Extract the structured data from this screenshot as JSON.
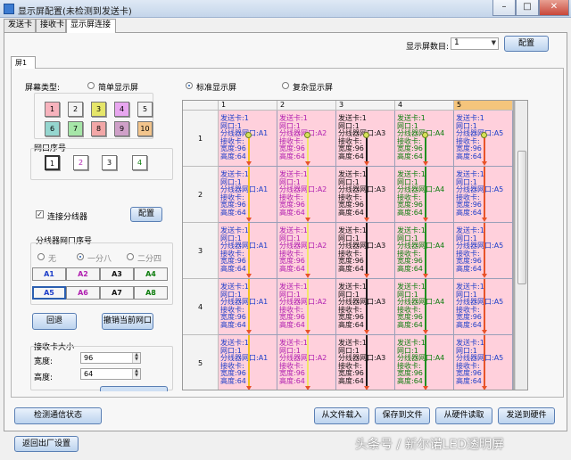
{
  "window": {
    "title": "显示屏配置(未检测到发送卡)",
    "minimize_glyph": "–",
    "maximize_glyph": "□",
    "close_glyph": "✕"
  },
  "main_tabs": [
    "发送卡",
    "接收卡",
    "显示屏连接"
  ],
  "screen_count": {
    "label": "显示屏数目:",
    "value": "1",
    "config_button": "配置"
  },
  "screen_tabs": [
    "屏1"
  ],
  "screen_type": {
    "label": "屏幕类型:",
    "options": [
      "简单显示屏",
      "标准显示屏",
      "复杂显示屏"
    ],
    "selected": "标准显示屏"
  },
  "palette": {
    "labels": [
      "1",
      "2",
      "3",
      "4",
      "5",
      "6",
      "7",
      "8",
      "9",
      "10"
    ],
    "colors": [
      "#f7b3bd",
      "#f2f2f2",
      "#e6e66a",
      "#e8a6ef",
      "#f3f3f3",
      "#95d6cf",
      "#a6e6a8",
      "#f2a7a7",
      "#cfa0c8",
      "#f3c58c"
    ]
  },
  "net_port": {
    "label": "网口序号",
    "items": [
      "1",
      "2",
      "3",
      "4"
    ]
  },
  "splitter": {
    "checkbox_label": "连接分线器",
    "checked": true,
    "config_button": "配置",
    "port_label": "分线器网口序号",
    "modes": [
      "无",
      "一分八",
      "二分四"
    ],
    "selected_mode": "一分八",
    "ports": [
      "A1",
      "A2",
      "A3",
      "A4",
      "A5",
      "A6",
      "A7",
      "A8"
    ]
  },
  "actions": {
    "undo": "回退",
    "cancel_port": "撤销当前网口"
  },
  "card_size": {
    "label": "接收卡大小",
    "width_label": "宽度:",
    "width": "96",
    "height_label": "高度:",
    "height": "64"
  },
  "grid": {
    "columns": [
      "1",
      "2",
      "3",
      "4",
      "5"
    ],
    "rows": [
      "1",
      "2",
      "3",
      "4",
      "5"
    ],
    "selected_column": "5",
    "cells": [
      {
        "card": "发送卡:1",
        "port": "网口:1",
        "splitter": "分线器网口:A1",
        "receive": "接收卡:",
        "width": "宽度:96",
        "height": "高度:64"
      },
      {
        "card": "发送卡:1",
        "port": "网口:1",
        "splitter": "分线器网口:A2",
        "receive": "接收卡:",
        "width": "宽度:96",
        "height": "高度:64"
      },
      {
        "card": "发送卡:1",
        "port": "网口:1",
        "splitter": "分线器网口:A3",
        "receive": "接收卡:",
        "width": "宽度:96",
        "height": "高度:64"
      },
      {
        "card": "发送卡:1",
        "port": "网口:1",
        "splitter": "分线器网口:A4",
        "receive": "接收卡:",
        "width": "宽度:96",
        "height": "高度:64"
      },
      {
        "card": "发送卡:1",
        "port": "网口:1",
        "splitter": "分线器网口:A5",
        "receive": "接收卡:",
        "width": "宽度:96",
        "height": "高度:64"
      }
    ],
    "column_colors": [
      "#ffd0dc",
      "#ffd0dc",
      "#ffd0dc",
      "#ffd0dc",
      "#ffd0dc"
    ],
    "text_colors": [
      "#1d3ec9",
      "#b01fb0",
      "#111111",
      "#0e7d0e",
      "#1d3ec9"
    ],
    "line_colors": [
      "#f2c21a",
      "#f2e66a",
      "#1a1a1a",
      "#1f8f1f",
      "#e8532a"
    ]
  },
  "bottom": {
    "detect": "检测通信状态",
    "load_file": "从文件载入",
    "save_file": "保存到文件",
    "read_hw": "从硬件读取",
    "send_hw": "发送到硬件",
    "factory": "返回出厂设置"
  },
  "watermark": "头条号 / 新尔诺LED透明屏"
}
